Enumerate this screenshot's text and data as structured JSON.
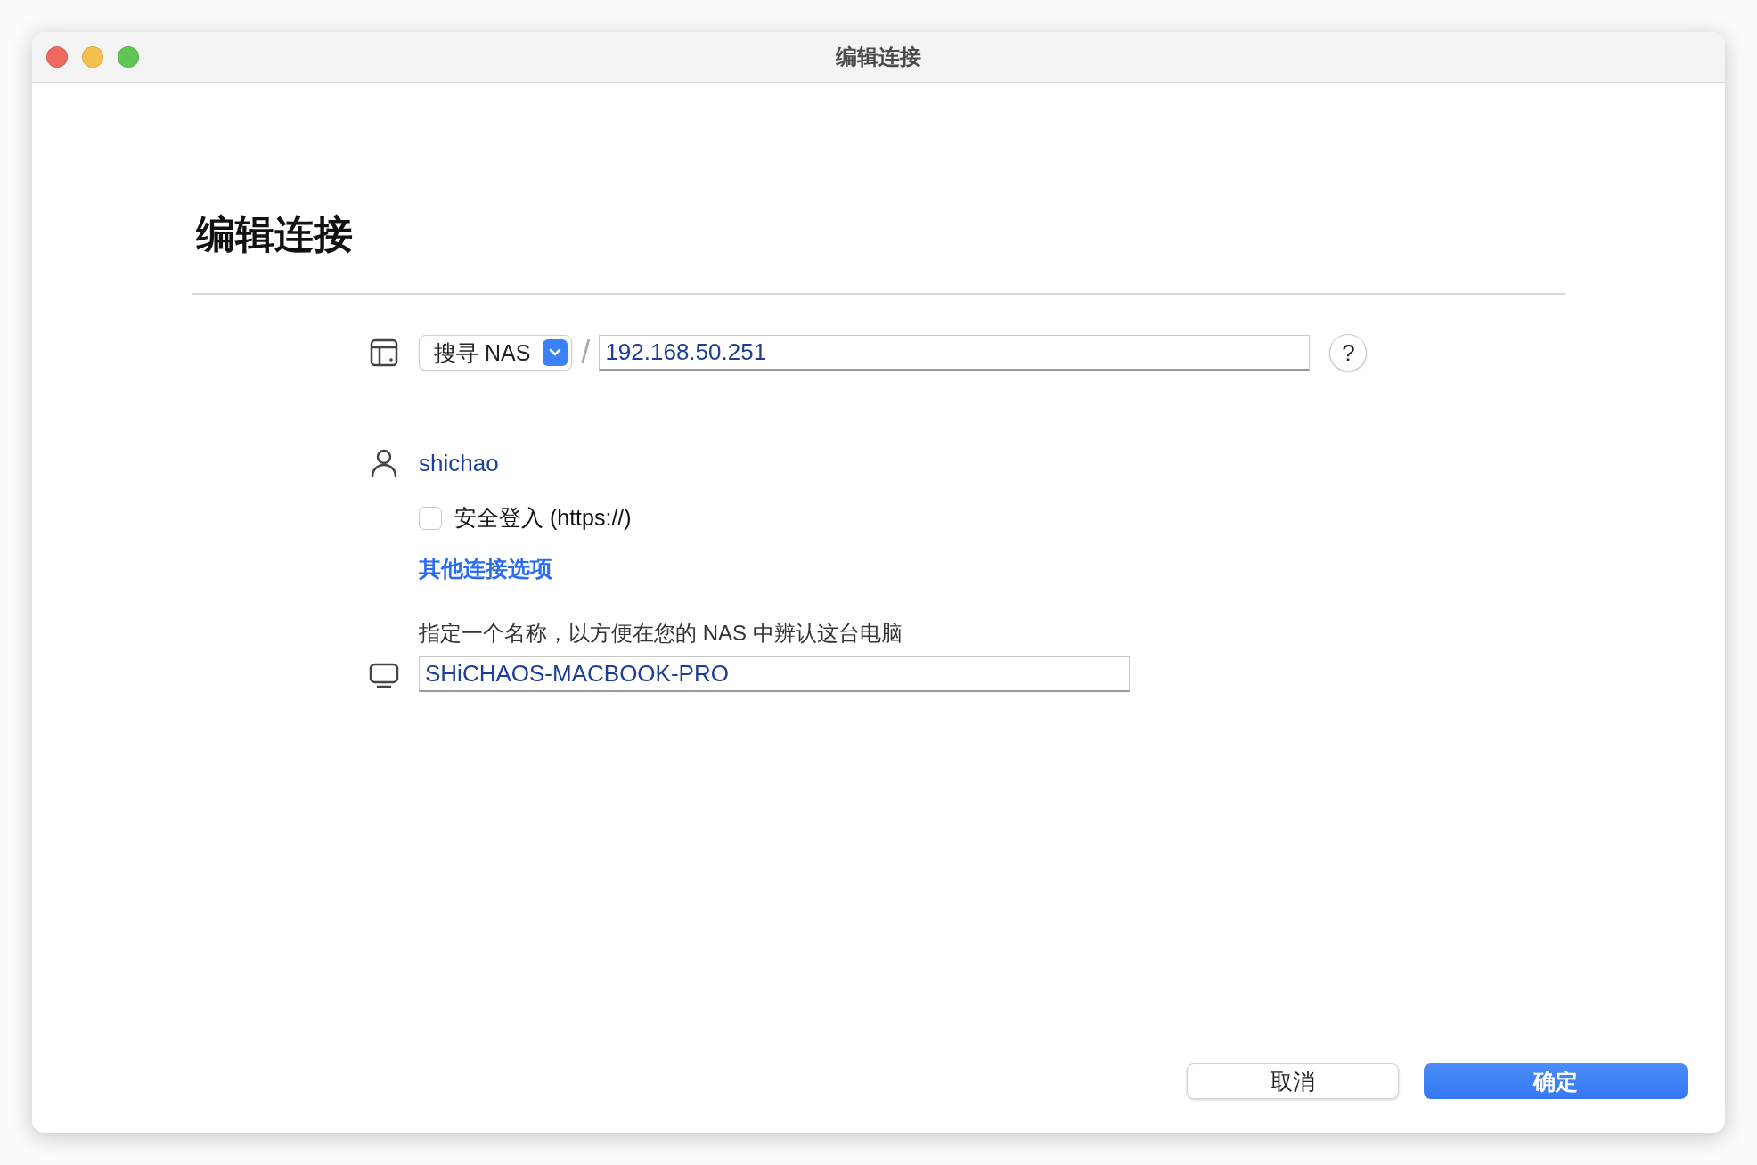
{
  "window": {
    "title": "编辑连接"
  },
  "heading": "编辑连接",
  "server": {
    "dropdown": "搜寻 NAS",
    "separator": "/",
    "address": "192.168.50.251",
    "help": "?"
  },
  "user": {
    "name": "shichao"
  },
  "secure_login": {
    "label": "安全登入 (https://)",
    "checked": false
  },
  "more_options_link": "其他连接选项",
  "computer_name": {
    "label": "指定一个名称，以方便在您的 NAS 中辨认这台电脑",
    "value": "SHiCHAOS-MACBOOK-PRO"
  },
  "buttons": [
    {
      "label": "取消",
      "kind": "secondary"
    },
    {
      "label": "确定",
      "kind": "primary"
    }
  ]
}
